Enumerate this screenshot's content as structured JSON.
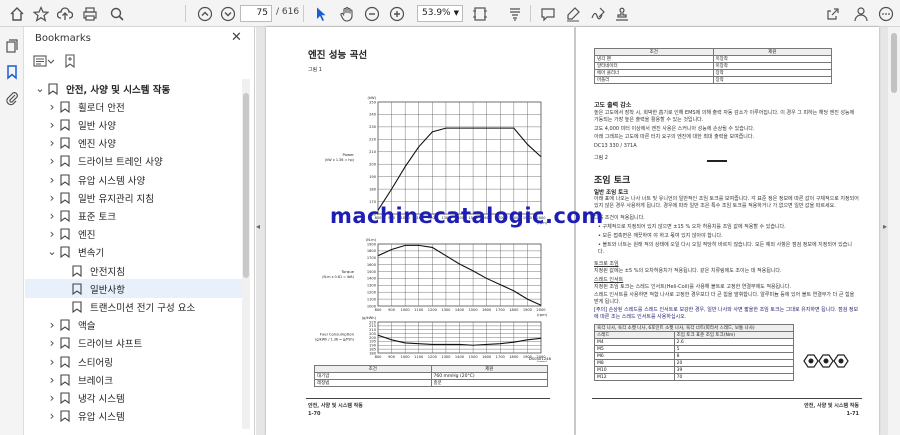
{
  "toolbar": {
    "page_current": "75",
    "page_total": "/ 616",
    "zoom": "53.9%",
    "icons": [
      "home-icon",
      "bookmark-star-icon",
      "upload-icon",
      "print-icon",
      "search-icon",
      "page-up-icon",
      "page-down-icon",
      "select-cursor-icon",
      "hand-icon",
      "zoom-out-icon",
      "zoom-in-icon",
      "fit-page-icon",
      "scroll-mode-icon",
      "comment-icon",
      "highlight-icon",
      "sign-icon",
      "stamp-icon",
      "share-link-icon",
      "user-icon"
    ]
  },
  "bookmarks_panel": {
    "title": "Bookmarks",
    "items": [
      {
        "label": "안전, 사양 및 시스템 작동",
        "level": 0,
        "state": "open",
        "selected": false
      },
      {
        "label": "휠로더 안전",
        "level": 1,
        "state": "closed",
        "selected": false
      },
      {
        "label": "일반 사양",
        "level": 1,
        "state": "closed",
        "selected": false
      },
      {
        "label": "엔진 사양",
        "level": 1,
        "state": "closed",
        "selected": false
      },
      {
        "label": "드라이브 트레인 사양",
        "level": 1,
        "state": "closed",
        "selected": false
      },
      {
        "label": "유압 시스템 사양",
        "level": 1,
        "state": "closed",
        "selected": false
      },
      {
        "label": "일반 유지관리 지침",
        "level": 1,
        "state": "closed",
        "selected": false
      },
      {
        "label": "표준 토크",
        "level": 1,
        "state": "closed",
        "selected": false
      },
      {
        "label": "엔진",
        "level": 1,
        "state": "closed",
        "selected": false
      },
      {
        "label": "변속기",
        "level": 1,
        "state": "open",
        "selected": false
      },
      {
        "label": "안전지침",
        "level": 2,
        "state": "none",
        "selected": false
      },
      {
        "label": "일반사항",
        "level": 2,
        "state": "none",
        "selected": true
      },
      {
        "label": "트랜스미션 전기 구성 요소",
        "level": 2,
        "state": "none",
        "selected": false
      },
      {
        "label": "액슬",
        "level": 1,
        "state": "closed",
        "selected": false
      },
      {
        "label": "드라이브 샤프트",
        "level": 1,
        "state": "closed",
        "selected": false
      },
      {
        "label": "스티어링",
        "level": 1,
        "state": "closed",
        "selected": false
      },
      {
        "label": "브레이크",
        "level": 1,
        "state": "closed",
        "selected": false
      },
      {
        "label": "냉각 시스템",
        "level": 1,
        "state": "closed",
        "selected": false
      },
      {
        "label": "유압 시스템",
        "level": 1,
        "state": "closed",
        "selected": false
      }
    ]
  },
  "left_page": {
    "heading": "엔진 성능 곡선",
    "fig_label": "그림 1",
    "code": "DS0401248",
    "footer_title": "안전, 사양 및 시스템 작동",
    "footer_page": "1-70",
    "table_headers": [
      "조건",
      "제원"
    ],
    "table_rows": [
      [
        "대기압",
        "760 mmHg (20°C)"
      ],
      [
        "레정법",
        "충분"
      ]
    ]
  },
  "right_page": {
    "top_table_headers": [
      "조건",
      "제원"
    ],
    "top_table_rows": [
      [
        "냉각 팬",
        "미장착"
      ],
      [
        "알터네이터",
        "미장착"
      ],
      [
        "에어 클리너",
        "장착"
      ],
      [
        "머플러",
        "장착"
      ]
    ],
    "section1": "고도 출력 감소",
    "para1": "높은 고도에서 장착 시, 희박한 흡기로 인해 EMS에 의해 출력 자동 감소가 이루어집니다. 이 경우 그 피하는 해당 엔진 성능에 가동되는 가장 높은 출력을 활용할 수 있는 것입니다.",
    "para2": "고도 4,000 미터 이상에서 엔진 사용은 스커니아 성능에 손상될 수 있습니다.",
    "para3": "아래 그래프는 고도에 따른 터치 요구의 엔진에 대한 최대 출력을 보여줍니다.",
    "model": "DC13 330 / 371A",
    "fig2_label": "그림 2",
    "section2": "조임 토크",
    "subsection": "일반 조임 토크",
    "body2": "아래 표에 나오는 나사 너트 및 유니언의 일반적인 조임 토크를 보여줍니다. 각 표준 정은 정보에 따른 값이 구체적으로 지정되어 있지 않은 경우 사용하게 됩니다. 경우에 따라 일반 조은 특수 조임 토크를 적용하거나 가 없으면 일반 값을 따르세요.",
    "note_label": "다음 조건이 적용됩니다.",
    "bullets": [
      "구체적으로 지정되어 있지 않으면 ±15 % 오차 허용치를 조임 값에 적용할 수 있습니다.",
      "모든 접촉면은 깨끗하여 야 하고 몫여 있지 않아야 합니다.",
      "볼트와 너트는 원래 적의 상태에 오일 다시 오일 적당히 바르지 않습니다. 모든 예외 사항은 점검 정보에 지정되어 있습니다."
    ],
    "torque_link": "토크로 조임",
    "torque_text": "지정된 값에는 ±5 %의 오차허용치가 적용됩니다. 같은 치류링에도 조이는 데 적용됩니다.",
    "screw_link": "스레드 인서트",
    "screw_text": "지정된 조임 토크는 스레드 인서트(Heli-Coil)를 사용해 볼트로 고정한 연결부에도 적용됩니다.",
    "thread_text": "스레드 인서트를 사용하면 적합 나사로 고정한 경우보다 더 큰 힘을 발휘합니다. 알루미늄 등에 있어 볼트 연결부가 더 큰 힘을 받게 됩니다.",
    "caution": "[주의] 손상된 스레드를 스레드 인서트로 보강한 경우, 일반 나사와 사면 짧을한 조임 토크는 그대로 유지하면 됩니다. 점검 정보에 따른 조는 스레드 인서트를 사용하십시오.",
    "torque_caption": "육각 나사, 육각 소켓 나사, 6포인트 소켓 나사, 육각 너트(따라서 스레드, 보통 나사)",
    "torque_headers": [
      "스레드",
      "조임 토크 표준 조임 토크(Nm)"
    ],
    "torque_rows": [
      [
        "M4",
        "2.6"
      ],
      [
        "M5",
        "5"
      ],
      [
        "M6",
        "8"
      ],
      [
        "M8",
        "20"
      ],
      [
        "M10",
        "39"
      ],
      [
        "M12",
        "70"
      ]
    ],
    "footer_title": "안전, 사양 및 시스템 작동",
    "footer_page": "1-71"
  },
  "watermark": "machinecatalogic.com",
  "chart_data": [
    {
      "type": "line",
      "title": "",
      "ylabel": "Power (kW x 1.36 = hp)",
      "yunit": "(kW)",
      "xunit": "(rpm)",
      "x": [
        800,
        900,
        1000,
        1100,
        1200,
        1300,
        1400,
        1500,
        1600,
        1700,
        1800,
        1900,
        2000
      ],
      "ylim": [
        160,
        250
      ],
      "yticks": [
        160,
        170,
        180,
        190,
        200,
        210,
        220,
        230,
        240,
        250
      ],
      "series": [
        {
          "values": [
            163,
            180,
            198,
            214,
            226,
            229,
            229,
            229,
            229,
            229,
            229,
            216,
            206
          ]
        }
      ]
    },
    {
      "type": "line",
      "title": "",
      "ylabel": "Torque (N.m x 0.81 = lbft)",
      "yunit": "(N.m)",
      "xunit": "(rpm)",
      "x": [
        800,
        900,
        1000,
        1100,
        1200,
        1300,
        1400,
        1500,
        1600,
        1700,
        1800,
        1900,
        2000
      ],
      "ylim": [
        1000,
        1900
      ],
      "yticks": [
        1000,
        1100,
        1200,
        1300,
        1400,
        1500,
        1600,
        1700,
        1800,
        1900
      ],
      "series": [
        {
          "values": [
            1730,
            1820,
            1880,
            1880,
            1850,
            1730,
            1610,
            1510,
            1400,
            1310,
            1220,
            1100,
            1010
          ]
        }
      ]
    },
    {
      "type": "line",
      "title": "",
      "ylabel": "Fuel Consumption (g/kWh / 1.36 = g/PSh)",
      "yunit": "(g/kWh)",
      "xunit": "(rpm)",
      "x": [
        800,
        900,
        1000,
        1100,
        1200,
        1300,
        1400,
        1500,
        1600,
        1700,
        1800,
        1900,
        2000
      ],
      "ylim": [
        180,
        220
      ],
      "yticks": [
        180,
        185,
        190,
        195,
        200,
        205,
        210,
        215,
        220
      ],
      "series": [
        {
          "values": [
            203,
            197,
            193,
            192,
            191,
            191,
            191,
            190,
            191,
            192,
            194,
            197,
            199
          ]
        }
      ]
    }
  ]
}
